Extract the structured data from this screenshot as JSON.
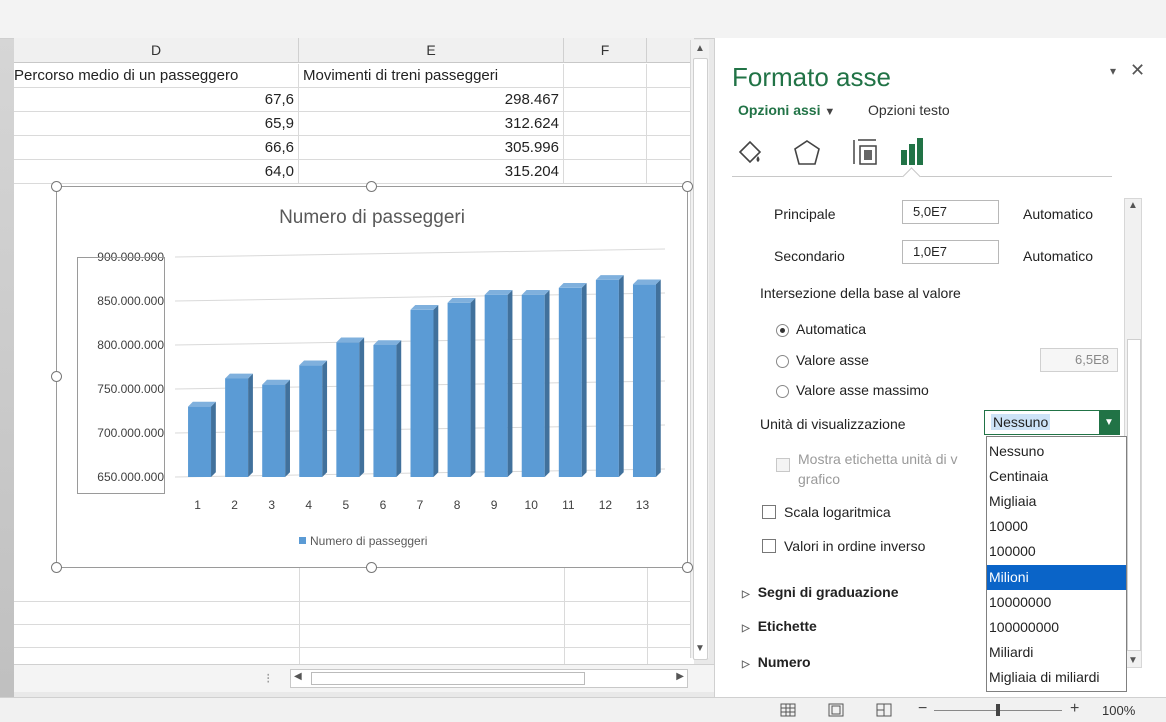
{
  "sheet": {
    "columns": [
      "D",
      "E",
      "F"
    ],
    "header_row": {
      "d": "Percorso medio di un passeggero",
      "e": "Movimenti di treni passeggeri"
    },
    "rows": [
      {
        "d": "67,6",
        "e": "298.467"
      },
      {
        "d": "65,9",
        "e": "312.624"
      },
      {
        "d": "66,6",
        "e": "305.996"
      },
      {
        "d": "64,0",
        "e": "315.204"
      }
    ]
  },
  "chart_data": {
    "type": "bar",
    "title": "Numero di passeggeri",
    "categories": [
      "1",
      "2",
      "3",
      "4",
      "5",
      "6",
      "7",
      "8",
      "9",
      "10",
      "11",
      "12",
      "13"
    ],
    "series": [
      {
        "name": "Numero di passeggeri",
        "values": [
          730000000,
          762000000,
          755000000,
          777000000,
          803000000,
          800000000,
          840000000,
          848000000,
          857000000,
          857000000,
          865000000,
          874000000,
          869000000
        ]
      }
    ],
    "ylim": [
      650000000,
      900000000
    ],
    "yticks": [
      "650.000.000",
      "700.000.000",
      "750.000.000",
      "800.000.000",
      "850.000.000",
      "900.000.000"
    ],
    "legend_label": "Numero di passeggeri",
    "color": "#5b9bd5"
  },
  "pane": {
    "title": "Formato asse",
    "tab_axis_options": "Opzioni assi",
    "tab_text_options": "Opzioni testo",
    "principale_label": "Principale",
    "principale_value": "5,0E7",
    "principale_auto": "Automatico",
    "secondario_label": "Secondario",
    "secondario_value": "1,0E7",
    "secondario_auto": "Automatico",
    "intersezione_label": "Intersezione della base al valore",
    "radio_auto": "Automatica",
    "radio_valore": "Valore asse",
    "radio_valore_value": "6,5E8",
    "radio_massimo": "Valore asse massimo",
    "unita_label": "Unità di visualizzazione",
    "unita_selected": "Nessuno",
    "mostra_etichetta": "Mostra etichetta unità di v",
    "mostra_etichetta_line2": "grafico",
    "scala_log": "Scala logaritmica",
    "ordine_inverso": "Valori in ordine inverso",
    "sections": [
      "Segni di graduazione",
      "Etichette",
      "Numero"
    ]
  },
  "dropdown": {
    "options": [
      "Nessuno",
      "Centinaia",
      "Migliaia",
      "10000",
      "100000",
      "Milioni",
      "10000000",
      "100000000",
      "Miliardi",
      "Migliaia di miliardi"
    ],
    "highlighted": "Milioni"
  },
  "status": {
    "zoom": "100%",
    "minus": "−",
    "plus": "+"
  },
  "icons": [
    "fill-line-icon",
    "effects-icon",
    "size-properties-icon",
    "axis-options-icon",
    "close-icon",
    "pane-menu-icon",
    "normal-view-icon",
    "page-layout-icon",
    "page-break-icon"
  ]
}
